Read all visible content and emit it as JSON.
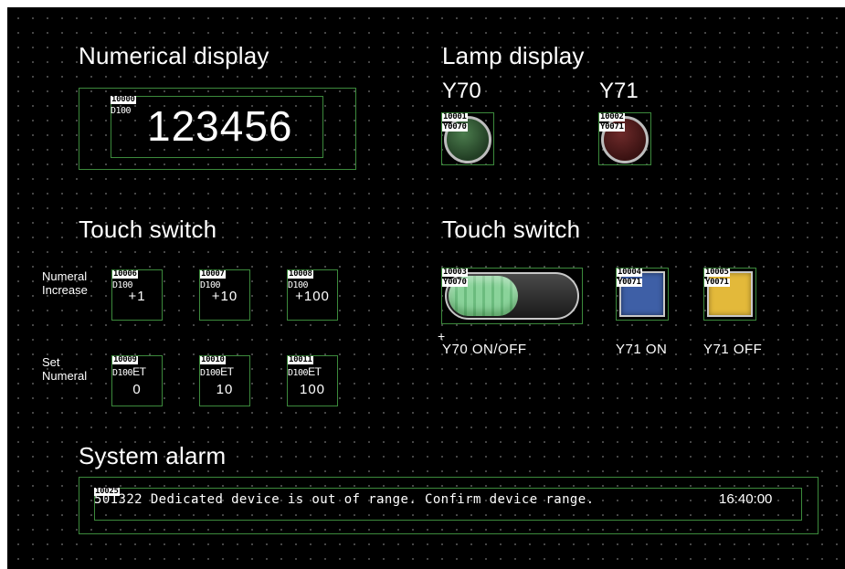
{
  "numerical_display": {
    "heading": "Numerical display",
    "object_id": "10000",
    "device": "D100",
    "value": "123456"
  },
  "lamp_display": {
    "heading": "Lamp display",
    "lamps": [
      {
        "label": "Y70",
        "object_id": "10001",
        "device": "Y0070",
        "state": "off",
        "color": "#2f5d32"
      },
      {
        "label": "Y71",
        "object_id": "10002",
        "device": "Y0071",
        "state": "off",
        "color": "#5a1d1d"
      }
    ]
  },
  "touch_switch_left": {
    "heading": "Touch switch",
    "row1_label_line1": "Numeral",
    "row1_label_line2": "Increase",
    "row2_label_line1": "Set",
    "row2_label_line2": "Numeral",
    "increase_buttons": [
      {
        "object_id": "10006",
        "device": "D100",
        "text": "+1"
      },
      {
        "object_id": "10007",
        "device": "D100",
        "text": "+10"
      },
      {
        "object_id": "10008",
        "device": "D100",
        "text": "+100"
      }
    ],
    "set_buttons": [
      {
        "object_id": "10009",
        "device": "D100",
        "set_tag": "ET",
        "text": "0"
      },
      {
        "object_id": "10010",
        "device": "D100",
        "set_tag": "ET",
        "text": "10"
      },
      {
        "object_id": "10011",
        "device": "D100",
        "set_tag": "ET",
        "text": "100"
      }
    ]
  },
  "touch_switch_right": {
    "heading": "Touch switch",
    "toggle": {
      "object_id": "10003",
      "device": "Y0070",
      "caption": "Y70 ON/OFF"
    },
    "on_button": {
      "object_id": "10004",
      "device": "Y0071",
      "caption": "Y71 ON",
      "color": "#3e5fa6"
    },
    "off_button": {
      "object_id": "10005",
      "device": "Y0071",
      "caption": "Y71 OFF",
      "color": "#e3b93a"
    }
  },
  "system_alarm": {
    "heading": "System alarm",
    "object_id": "10025",
    "code_prefix": "501",
    "message": "322 Dedicated device is out of range. Confirm device range.",
    "time": "16:40:00"
  },
  "colors": {
    "background": "#000000",
    "frame": "#3c8a3c",
    "grid_dot": "#5a5a5a"
  }
}
